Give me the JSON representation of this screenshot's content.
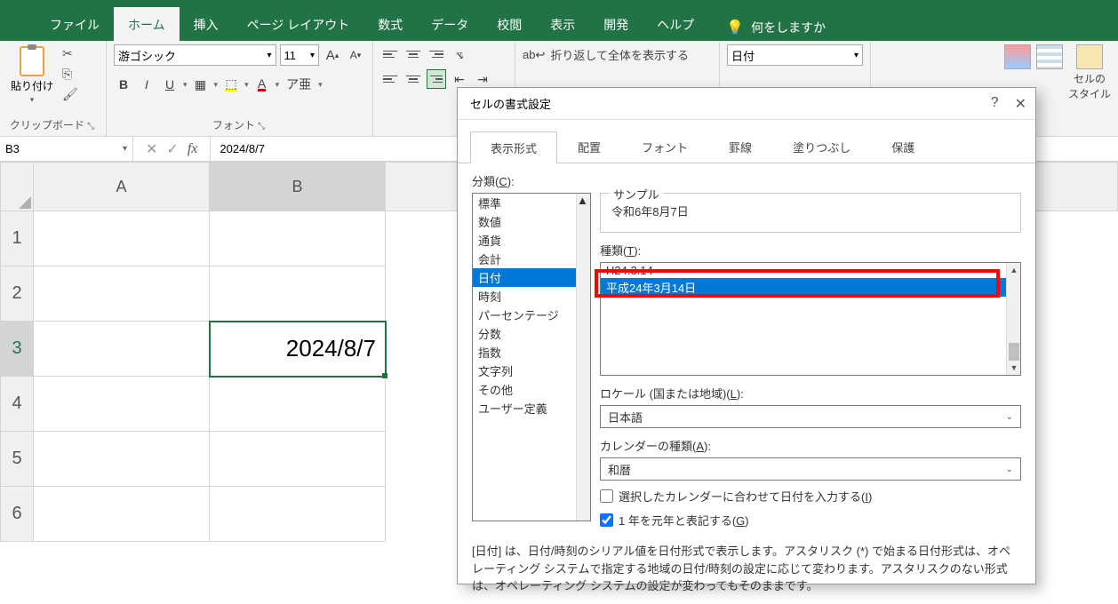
{
  "ribbon": {
    "tabs": [
      "ファイル",
      "ホーム",
      "挿入",
      "ページ レイアウト",
      "数式",
      "データ",
      "校閲",
      "表示",
      "開発",
      "ヘルプ"
    ],
    "active_tab": "ホーム",
    "tellme": "何をしますか",
    "clipboard": {
      "label": "クリップボード",
      "paste": "貼り付け"
    },
    "font": {
      "label": "フォント",
      "name": "游ゴシック",
      "size": "11",
      "bold": "B",
      "italic": "I",
      "underline": "U",
      "increase": "A",
      "decrease": "A"
    },
    "alignment": {
      "wrap_text": "折り返して全体を表示する"
    },
    "number": {
      "format": "日付"
    },
    "styles": {
      "cell_styles": "セルの\nスタイル"
    }
  },
  "namebox": "B3",
  "formula": "2024/8/7",
  "grid": {
    "cols": [
      "A",
      "B"
    ],
    "rows": [
      "1",
      "2",
      "3",
      "4",
      "5",
      "6"
    ],
    "active_cell_value": "2024/8/7"
  },
  "dialog": {
    "title": "セルの書式設定",
    "tabs": [
      "表示形式",
      "配置",
      "フォント",
      "罫線",
      "塗りつぶし",
      "保護"
    ],
    "active_tab": "表示形式",
    "category_label": "分類(C):",
    "categories": [
      "標準",
      "数値",
      "通貨",
      "会計",
      "日付",
      "時刻",
      "パーセンテージ",
      "分数",
      "指数",
      "文字列",
      "その他",
      "ユーザー定義"
    ],
    "selected_category": "日付",
    "sample_label": "サンプル",
    "sample_value": "令和6年8月7日",
    "type_label": "種類(T):",
    "type_items": [
      "H24.3.14",
      "平成24年3月14日"
    ],
    "selected_type": "平成24年3月14日",
    "locale_label": "ロケール (国または地域)(L):",
    "locale_value": "日本語",
    "calendar_label": "カレンダーの種類(A):",
    "calendar_value": "和暦",
    "chk1_label": "選択したカレンダーに合わせて日付を入力する(I)",
    "chk1_checked": false,
    "chk2_label": "1 年を元年と表記する(G)",
    "chk2_checked": true,
    "explain": "[日付] は、日付/時刻のシリアル値を日付形式で表示します。アスタリスク (*) で始まる日付形式は、オペレーティング システムで指定する地域の日付/時刻の設定に応じて変わります。アスタリスクのない形式は、オペレーティング システムの設定が変わってもそのままです。"
  }
}
